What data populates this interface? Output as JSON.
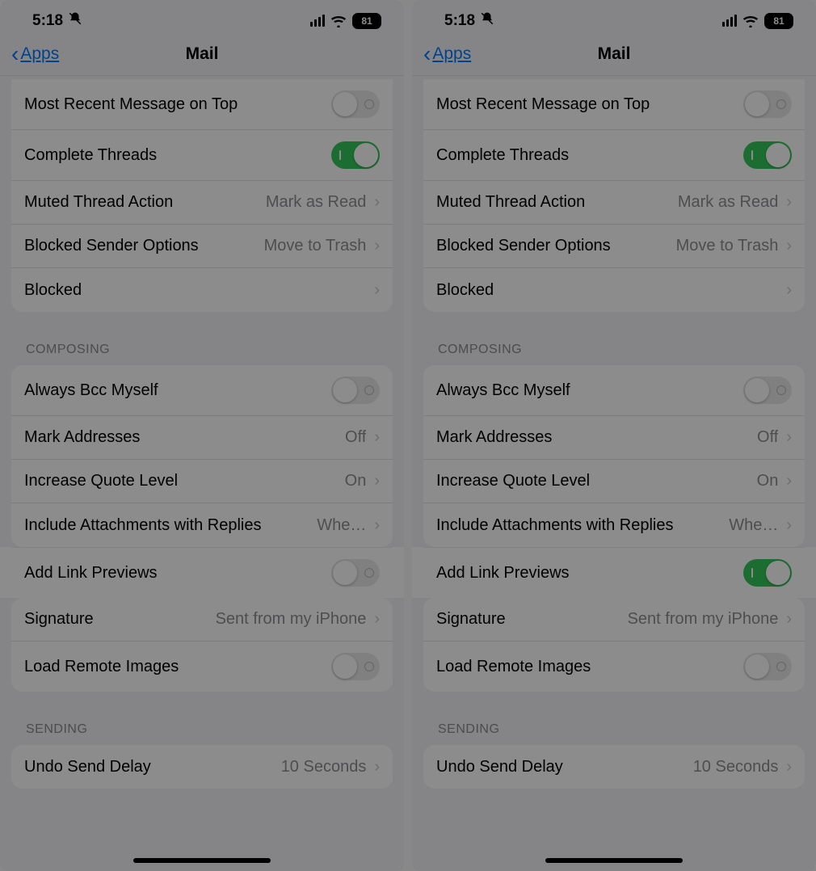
{
  "status": {
    "time": "5:18",
    "battery": "81"
  },
  "nav": {
    "back_label": "Apps",
    "title": "Mail"
  },
  "threading": {
    "most_recent": {
      "label": "Most Recent Message on Top",
      "on": false
    },
    "complete_threads": {
      "label": "Complete Threads",
      "on": true
    },
    "muted_action": {
      "label": "Muted Thread Action",
      "value": "Mark as Read"
    },
    "blocked_sender": {
      "label": "Blocked Sender Options",
      "value": "Move to Trash"
    },
    "blocked": {
      "label": "Blocked"
    }
  },
  "composing": {
    "header": "COMPOSING",
    "always_bcc": {
      "label": "Always Bcc Myself",
      "on": false
    },
    "mark_addresses": {
      "label": "Mark Addresses",
      "value": "Off"
    },
    "increase_quote": {
      "label": "Increase Quote Level",
      "value": "On"
    },
    "include_attachments": {
      "label": "Include Attachments with Replies",
      "value": "Whe…"
    },
    "add_link_previews": {
      "label": "Add Link Previews"
    },
    "signature": {
      "label": "Signature",
      "value": "Sent from my iPhone"
    },
    "load_remote": {
      "label": "Load Remote Images",
      "on": false
    }
  },
  "sending": {
    "header": "SENDING",
    "undo_delay": {
      "label": "Undo Send Delay",
      "value": "10 Seconds"
    }
  },
  "panes": {
    "left": {
      "add_link_previews_on": false
    },
    "right": {
      "add_link_previews_on": true
    }
  }
}
